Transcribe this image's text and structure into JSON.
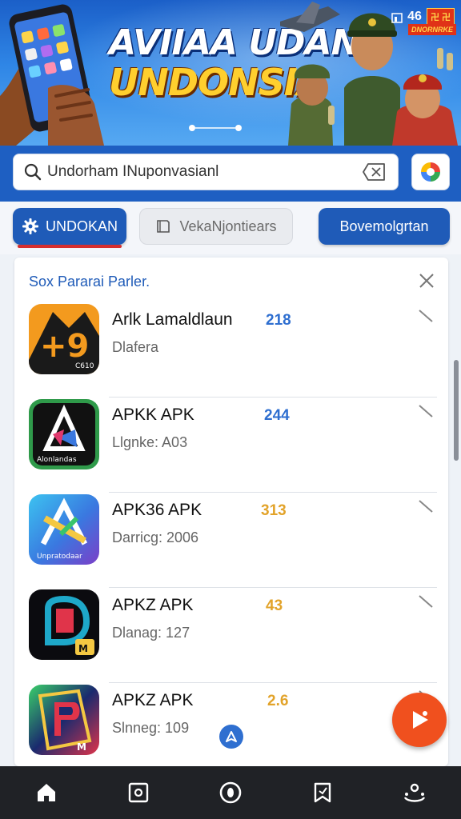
{
  "status": {
    "signal_value": "46",
    "flag_text": "卍 卍"
  },
  "banner": {
    "title_line1": "AVIIAA UDAN",
    "title_line2": "UNDONSIA",
    "corner_badge": "DNORNRKE"
  },
  "search": {
    "value": "Undorham INuponvasianl",
    "clear_icon": "close-icon"
  },
  "tabs": {
    "primary_label": "UNDOKAN",
    "secondary_label": "VekaNjontiears",
    "third_label": "Bovemolgrtan"
  },
  "panel": {
    "title": "Sox Pararai Parler.",
    "items": [
      {
        "name": "Arlk Lamaldlaun",
        "sub": "Dlafera",
        "score": "218",
        "score_color": "#2f6fd0",
        "icon_text": "+9",
        "icon_caption": "C610"
      },
      {
        "name": "APKK APK",
        "sub": "Llgnke: A03",
        "score": "244",
        "score_color": "#2f6fd0",
        "icon_text": "",
        "icon_caption": "Alonlandas"
      },
      {
        "name": "APK36 APK",
        "sub": "Darricg: 2006",
        "score": "313",
        "score_color": "#e2a32a",
        "icon_text": "",
        "icon_caption": "Unpratodaar"
      },
      {
        "name": "APKZ APK",
        "sub": "Dlanag: 127",
        "score": "43",
        "score_color": "#e2a32a",
        "icon_text": "",
        "icon_caption": "M"
      },
      {
        "name": "APKZ APK",
        "sub": "Slnneg: 109",
        "score": "2.6",
        "score_color": "#e2a32a",
        "icon_text": "",
        "icon_caption": "M"
      }
    ]
  },
  "colors": {
    "brand_blue": "#1f5bb8",
    "accent_red": "#d62e2e",
    "fab_orange": "#f0501e"
  }
}
